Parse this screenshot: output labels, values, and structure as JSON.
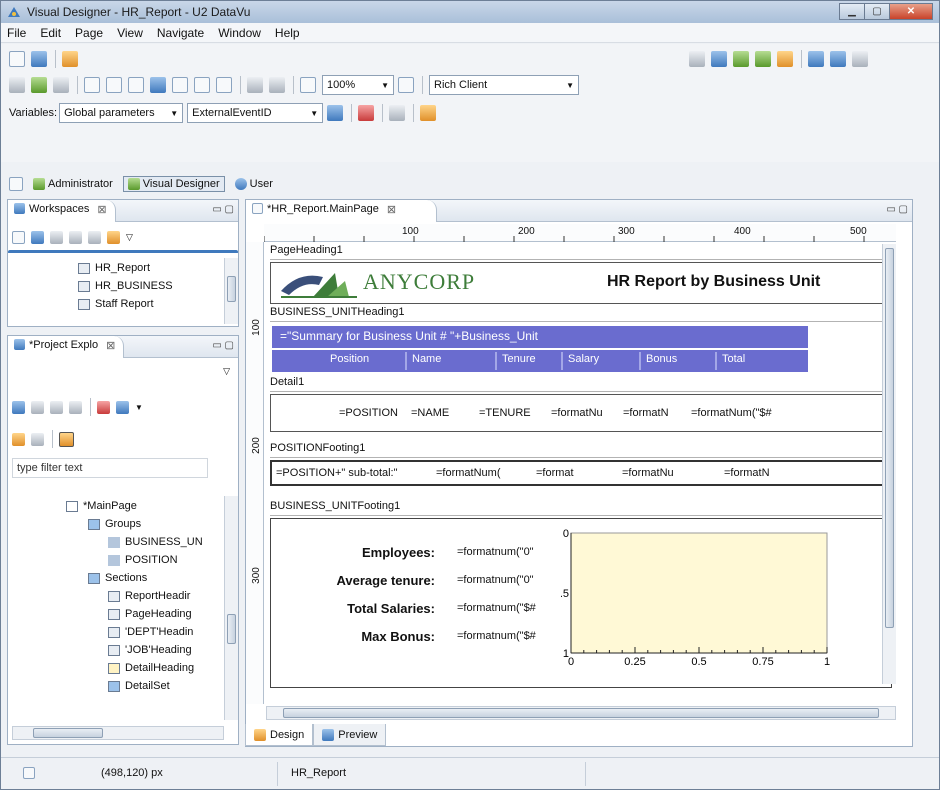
{
  "window": {
    "title": "Visual Designer - HR_Report - U2 DataVu",
    "controls": [
      "minimize",
      "maximize",
      "close"
    ]
  },
  "menu": [
    "File",
    "Edit",
    "Page",
    "View",
    "Navigate",
    "Window",
    "Help"
  ],
  "toolbar": {
    "zoom": "100%",
    "client": "Rich Client",
    "variables_label": "Variables:",
    "variables_scope": "Global parameters",
    "variables_name": "ExternalEventID"
  },
  "perspectives": [
    "Administrator",
    "Visual Designer",
    "User"
  ],
  "workspaces": {
    "tab": "Workspaces",
    "items": [
      "HR_Report",
      "HR_BUSINESS",
      "Staff Report"
    ]
  },
  "project": {
    "tab": "*Project Explo",
    "filter_placeholder": "type filter text",
    "tree": [
      {
        "label": "*MainPage",
        "level": 0
      },
      {
        "label": "Groups",
        "level": 1
      },
      {
        "label": "BUSINESS_UN",
        "level": 2
      },
      {
        "label": "POSITION",
        "level": 2
      },
      {
        "label": "Sections",
        "level": 1
      },
      {
        "label": "ReportHeadir",
        "level": 2
      },
      {
        "label": "PageHeading",
        "level": 2
      },
      {
        "label": "'DEPT'Headin",
        "level": 2
      },
      {
        "label": "'JOB'Heading",
        "level": 2
      },
      {
        "label": "DetailHeading",
        "level": 2
      },
      {
        "label": "DetailSet",
        "level": 2
      }
    ]
  },
  "editor": {
    "tab": "*HR_Report.MainPage",
    "ruler_top": [
      "100",
      "200",
      "300",
      "400",
      "500"
    ],
    "ruler_left": [
      "100",
      "200",
      "300"
    ],
    "sections": {
      "page_heading": "PageHeading1",
      "bu_heading": "BUSINESS_UNITHeading1",
      "detail": "Detail1",
      "position_footing": "POSITIONFooting1",
      "bu_footing": "BUSINESS_UNITFooting1"
    },
    "logo_text": "ANYCORP",
    "report_title": "HR Report by Business Unit",
    "summary_expr": "=\"Summary for Business Unit # \"+Business_Unit",
    "columns": [
      "Position",
      "Name",
      "Tenure",
      "Salary",
      "Bonus",
      "Total"
    ],
    "detail_fields": [
      "=POSITION",
      "=NAME",
      "=TENURE",
      "=formatNu",
      "=formatN",
      "=formatNum(\"$#"
    ],
    "footing_fields": [
      "=POSITION+\" sub-total:\"",
      "=formatNum(",
      "=format",
      "=formatNu",
      "=formatN"
    ],
    "summary_labels": [
      "Employees:",
      "Average tenure:",
      "Total Salaries:",
      "Max Bonus:"
    ],
    "summary_values": [
      "=formatnum(\"0\"",
      "=formatnum(\"0\"",
      "=formatnum(\"$#",
      "=formatnum(\"$#"
    ],
    "bottom_tabs": [
      "Design",
      "Preview"
    ]
  },
  "chart_data": {
    "type": "area",
    "xlabel": "",
    "ylabel": "",
    "x_ticks": [
      "0",
      "0.25",
      "0.5",
      "0.75",
      "1"
    ],
    "y_ticks": [
      "0",
      "0.5",
      "1"
    ],
    "xlim": [
      0,
      1
    ],
    "ylim": [
      0,
      1
    ],
    "series": []
  },
  "status": {
    "coords": "(498,120) px",
    "report": "HR_Report"
  },
  "colors": {
    "header_bar": "#6a6ccf",
    "chart_fill": "#fff9d6"
  }
}
